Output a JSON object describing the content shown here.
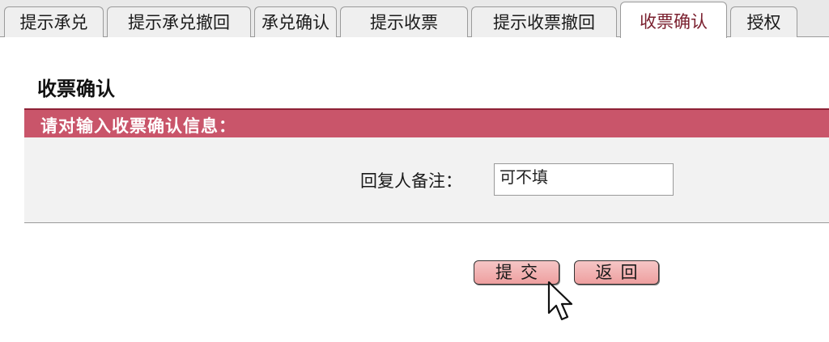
{
  "tabs": [
    {
      "label": "提示承兑",
      "active": false
    },
    {
      "label": "提示承兑撤回",
      "active": false
    },
    {
      "label": "承兑确认",
      "active": false
    },
    {
      "label": "提示收票",
      "active": false
    },
    {
      "label": "提示收票撤回",
      "active": false
    },
    {
      "label": "收票确认",
      "active": true
    },
    {
      "label": "授权",
      "active": false
    }
  ],
  "page": {
    "title": "收票确认",
    "section_header": "请对输入收票确认信息："
  },
  "form": {
    "remark_label": "回复人备注：",
    "remark_value": "可不填"
  },
  "buttons": {
    "submit": "提交",
    "back": "返回"
  },
  "colors": {
    "section_bar": "#c9556a",
    "active_tab_text": "#7a1f2e",
    "button_fill": "#f0a8a8"
  }
}
